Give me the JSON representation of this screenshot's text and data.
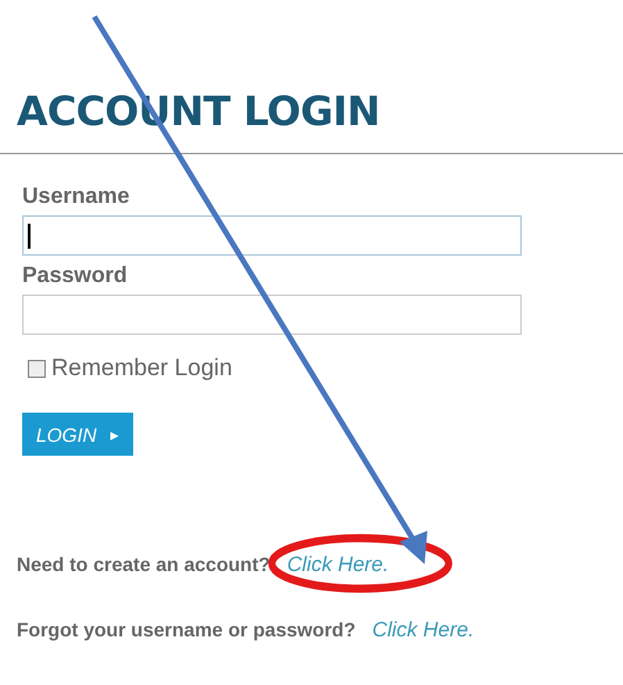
{
  "title": "ACCOUNT LOGIN",
  "fields": [
    {
      "label": "Username",
      "focused": true
    },
    {
      "label": "Password",
      "focused": false
    }
  ],
  "remember": {
    "label": "Remember Login",
    "checked": false
  },
  "login_button": {
    "label": "LOGIN",
    "icon": "▸"
  },
  "links": [
    {
      "text": "Need to create an account?",
      "link": "Click Here."
    },
    {
      "text": "Forgot your username or password?",
      "link": "Click Here."
    }
  ]
}
